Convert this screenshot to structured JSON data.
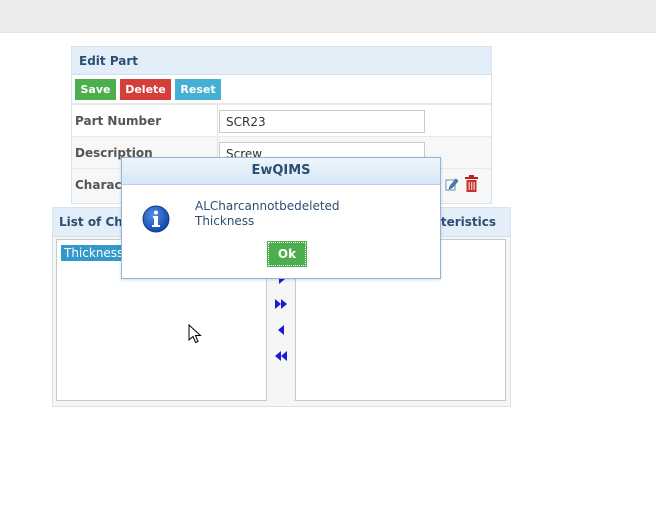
{
  "panel": {
    "title": "Edit Part",
    "buttons": {
      "save": "Save",
      "delete": "Delete",
      "reset": "Reset"
    },
    "rows": [
      {
        "label": "Part Number",
        "value": "SCR23"
      },
      {
        "label": "Description",
        "value": "Screw"
      },
      {
        "label": "Charact"
      }
    ]
  },
  "characteristics": {
    "left_title": "List of Cha",
    "right_title": "cteristics",
    "left_items": [
      "Thickness"
    ]
  },
  "dialog": {
    "title": "EwQIMS",
    "message_line1": "ALCharcannotbedeleted",
    "message_line2": "Thickness",
    "ok": "Ok"
  },
  "colors": {
    "save": "#4cae4c",
    "delete": "#d43f3a",
    "reset": "#46b0d4",
    "header_text": "#2c4f74",
    "selection": "#3399cc"
  },
  "icons": {
    "edit": "pencil-icon",
    "delete": "trash-icon",
    "info": "info-icon",
    "arrows": [
      "arrow-right-icon",
      "double-arrow-right-icon",
      "arrow-left-icon",
      "double-arrow-left-icon"
    ]
  }
}
